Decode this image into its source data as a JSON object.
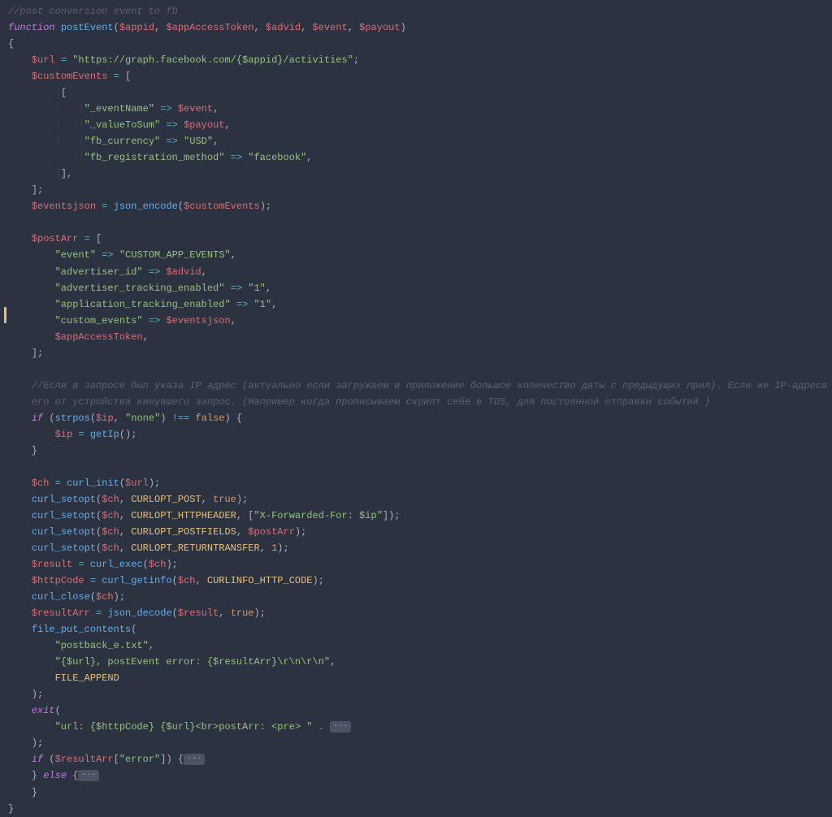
{
  "line1_comment": "//post conversion event to fb",
  "func_kw": "function",
  "func_name": "postEvent",
  "params": {
    "p1": "$appid",
    "p2": "$appAccessToken",
    "p3": "$advid",
    "p4": "$event",
    "p5": "$payout"
  },
  "url_var": "$url",
  "url_val": "\"https://graph.facebook.com/{$appid}/activities\"",
  "customEvents_var": "$customEvents",
  "ce_k_eventName": "\"_eventName\"",
  "ce_v_event": "$event",
  "ce_k_valueToSum": "\"_valueToSum\"",
  "ce_v_payout": "$payout",
  "ce_k_fbCurrency": "\"fb_currency\"",
  "ce_v_usd": "\"USD\"",
  "ce_k_fbReg": "\"fb_registration_method\"",
  "ce_v_fb": "\"facebook\"",
  "eventsjson_var": "$eventsjson",
  "json_encode": "json_encode",
  "customEvents_ref": "$customEvents",
  "postArr_var": "$postArr",
  "pa_k_event": "\"event\"",
  "pa_v_cae": "\"CUSTOM_APP_EVENTS\"",
  "pa_k_advid": "\"advertiser_id\"",
  "pa_v_advid": "$advid",
  "pa_k_ate": "\"advertiser_tracking_enabled\"",
  "pa_v_1a": "\"1\"",
  "pa_k_apte": "\"application_tracking_enabled\"",
  "pa_v_1b": "\"1\"",
  "pa_k_ce": "\"custom_events\"",
  "pa_v_ej": "$eventsjson",
  "pa_appAccess": "$appAccessToken",
  "ru_comment1": "//Если в запросе был указа IP адрес (актуально если загружаем в приложение большое количество даты с предыдущих прил). Если же IP-адреса в запросе не было, то получаем",
  "ru_comment2": "его от устройства кинувшего запрос. (Например когда прописываем скрипт себе в TDS, для постоянной отправки событий )",
  "if_kw": "if",
  "strpos": "strpos",
  "ip_var": "$ip",
  "none_str": "\"none\"",
  "neq": "!==",
  "false_kw": "false",
  "getIp": "getIp",
  "ch_var": "$ch",
  "curl_init": "curl_init",
  "url_ref": "$url",
  "curl_setopt": "curl_setopt",
  "ch_ref": "$ch",
  "CURLOPT_POST": "CURLOPT_POST",
  "true_kw": "true",
  "CURLOPT_HTTPHEADER": "CURLOPT_HTTPHEADER",
  "xff_str": "\"X-Forwarded-For: $ip\"",
  "CURLOPT_POSTFIELDS": "CURLOPT_POSTFIELDS",
  "postArr_ref": "$postArr",
  "CURLOPT_RETURNTRANSFER": "CURLOPT_RETURNTRANSFER",
  "one": "1",
  "result_var": "$result",
  "curl_exec": "curl_exec",
  "httpCode_var": "$httpCode",
  "curl_getinfo": "curl_getinfo",
  "CURLINFO_HTTP_CODE": "CURLINFO_HTTP_CODE",
  "curl_close": "curl_close",
  "resultArr_var": "$resultArr",
  "json_decode": "json_decode",
  "result_ref": "$result",
  "file_put_contents": "file_put_contents",
  "fpc_file": "\"postback_e.txt\"",
  "fpc_content": "\"{$url}, postEvent error: {$resultArr}\\r\\n\\r\\n\"",
  "FILE_APPEND": "FILE_APPEND",
  "exit_kw": "exit",
  "exit_str": "\"url: {$httpCode} {$url}<br>postArr: <pre> \"",
  "dot": ".",
  "fold": "···",
  "resultArr_ref": "$resultArr",
  "error_str": "\"error\"",
  "else_kw": "else"
}
